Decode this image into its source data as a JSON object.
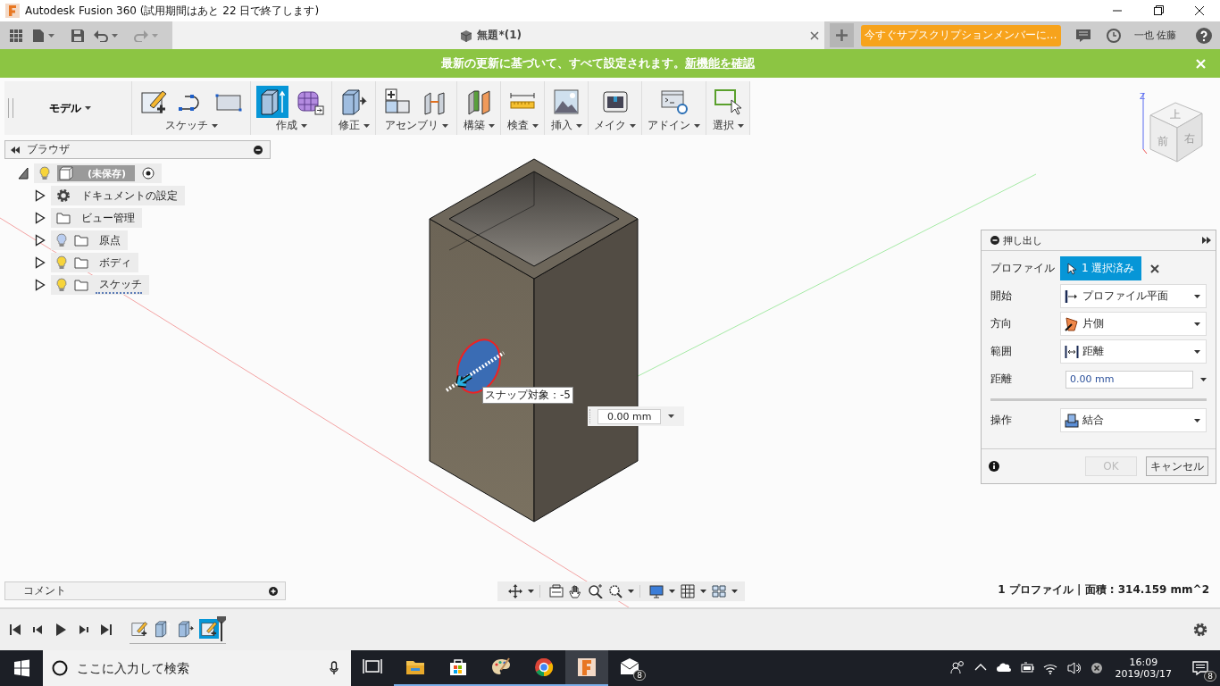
{
  "window": {
    "title": "Autodesk Fusion 360 (試用期間はあと 22 日で終了します)"
  },
  "document_tab": {
    "title": "無題*(1)",
    "selected": true
  },
  "subscribe_button": "今すぐサブスクリプションメンバーに…",
  "user": "一也 佐藤",
  "banner": {
    "text": "最新の更新に基づいて、すべて設定されます。",
    "link": "新機能を確認"
  },
  "workspace": "モデル",
  "toolbar_groups": [
    {
      "label": "スケッチ",
      "tools": [
        {
          "kind": "sketch",
          "selected": false
        },
        {
          "kind": "arc",
          "selected": false
        },
        {
          "kind": "rectangle",
          "selected": false
        }
      ]
    },
    {
      "label": "作成",
      "tools": [
        {
          "kind": "extrude",
          "selected": true
        },
        {
          "kind": "form",
          "selected": false
        }
      ]
    },
    {
      "label": "修正",
      "tools": [
        {
          "kind": "modify",
          "selected": false
        }
      ]
    },
    {
      "label": "アセンブリ",
      "tools": [
        {
          "kind": "assemble",
          "selected": false
        },
        {
          "kind": "joint",
          "selected": false
        }
      ]
    },
    {
      "label": "構築",
      "tools": [
        {
          "kind": "plane",
          "selected": false
        }
      ]
    },
    {
      "label": "検査",
      "tools": [
        {
          "kind": "measure",
          "selected": false
        }
      ]
    },
    {
      "label": "挿入",
      "tools": [
        {
          "kind": "insert",
          "selected": false
        }
      ]
    },
    {
      "label": "メイク",
      "tools": [
        {
          "kind": "make",
          "selected": false
        }
      ]
    },
    {
      "label": "アドイン",
      "tools": [
        {
          "kind": "addin",
          "selected": false
        }
      ]
    },
    {
      "label": "選択",
      "tools": [
        {
          "kind": "select",
          "selected": false
        }
      ]
    }
  ],
  "browser": {
    "title": "ブラウザ",
    "root": {
      "label": "(未保存)",
      "expanded": true,
      "visible": true,
      "active": true,
      "children": [
        {
          "label": "ドキュメントの設定",
          "kind": "settings",
          "expanded": false
        },
        {
          "label": "ビュー管理",
          "kind": "folder",
          "expanded": false
        },
        {
          "label": "原点",
          "kind": "folder",
          "expanded": false,
          "visible": false
        },
        {
          "label": "ボディ",
          "kind": "folder",
          "expanded": false,
          "visible": true
        },
        {
          "label": "スケッチ",
          "kind": "sketch-folder",
          "expanded": false,
          "visible": true
        }
      ]
    }
  },
  "viewcube": {
    "top": "上",
    "front": "前",
    "right": "右",
    "axis": "Z"
  },
  "viewport": {
    "snap_label": "スナップ対象：-5",
    "distance": "0.00 mm"
  },
  "dialog": {
    "title": "押し出し",
    "rows": [
      {
        "label": "プロファイル",
        "kind": "selection",
        "value": "1 選択済み"
      },
      {
        "label": "開始",
        "kind": "dropdown",
        "value": "プロファイル平面"
      },
      {
        "label": "方向",
        "kind": "dropdown",
        "value": "片側"
      },
      {
        "label": "範囲",
        "kind": "dropdown",
        "value": "距離"
      },
      {
        "label": "距離",
        "kind": "input",
        "value": "0.00 mm"
      }
    ],
    "operation": {
      "label": "操作",
      "kind": "dropdown",
      "value": "結合"
    },
    "buttons": [
      {
        "label": "OK",
        "disabled": true
      },
      {
        "label": "キャンセル",
        "disabled": false
      }
    ]
  },
  "comments": {
    "title": "コメント"
  },
  "status": "1 プロファイル | 面積 : 314.159 mm^2",
  "timeline": [
    {
      "kind": "sketch",
      "selected": false
    },
    {
      "kind": "extrude",
      "selected": false
    },
    {
      "kind": "modify",
      "selected": false
    },
    {
      "kind": "sketch",
      "selected": true
    }
  ],
  "taskbar": {
    "search_placeholder": "ここに入力して検索",
    "apps": [
      {
        "kind": "task-view",
        "running": false,
        "active": false
      },
      {
        "kind": "explorer",
        "running": true,
        "active": false
      },
      {
        "kind": "store",
        "running": true,
        "active": false
      },
      {
        "kind": "paint",
        "running": true,
        "active": false
      },
      {
        "kind": "chrome",
        "running": true,
        "active": false
      },
      {
        "kind": "fusion",
        "running": true,
        "active": true
      },
      {
        "kind": "mail",
        "running": false,
        "active": false,
        "badge": "8"
      }
    ],
    "time": "16:09",
    "date": "2019/03/17",
    "notifications": "8"
  }
}
